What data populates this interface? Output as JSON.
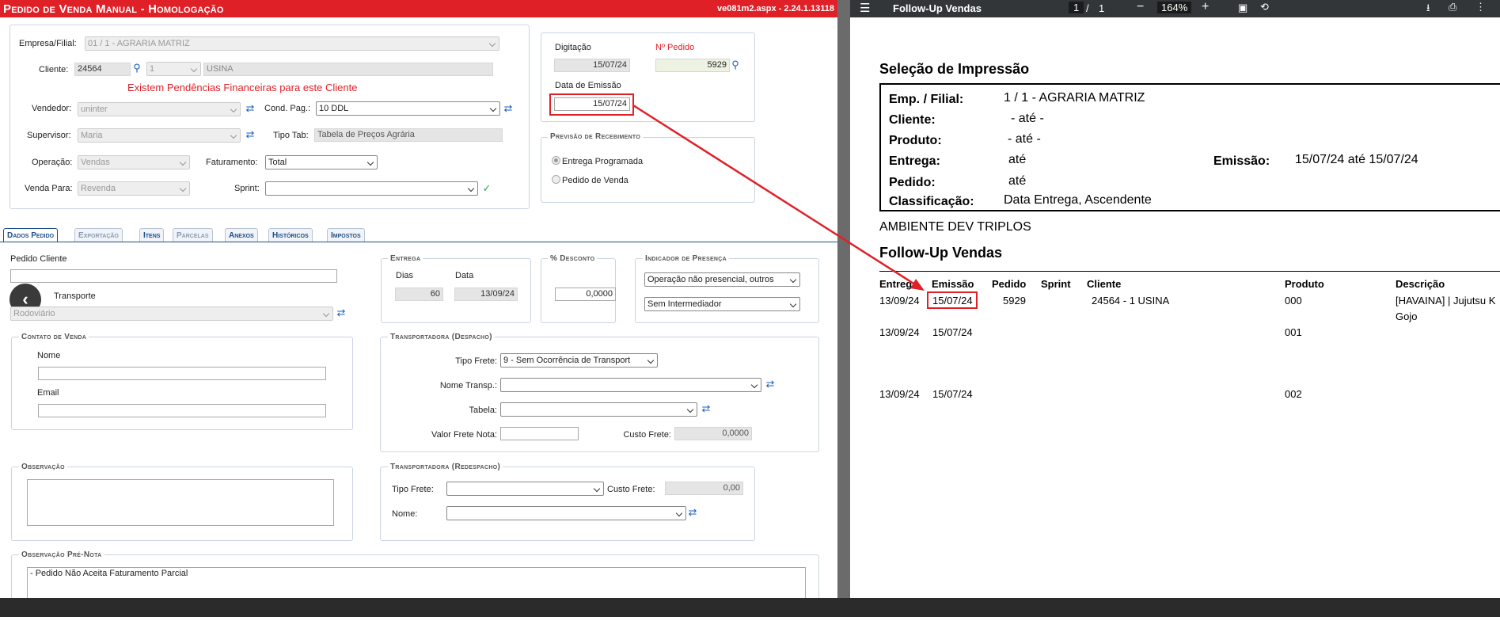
{
  "app": {
    "title": "Pedido de Venda Manual",
    "env": "- Homologação",
    "version": "ve081m2.aspx - 2.24.1.13118"
  },
  "header": {
    "empresa_label": "Empresa/Filial:",
    "empresa_value": "01 / 1 - AGRARIA MATRIZ",
    "cliente_label": "Cliente:",
    "cliente_code": "24564",
    "cliente_loja": "1",
    "cliente_name": "USINA",
    "warning": "Existem Pendências Financeiras para este Cliente",
    "vendedor_label": "Vendedor:",
    "vendedor_value": "uninter",
    "condpag_label": "Cond. Pag.:",
    "condpag_value": "10 DDL",
    "supervisor_label": "Supervisor:",
    "supervisor_value": "Maria",
    "tipotab_label": "Tipo Tab:",
    "tipotab_value": "Tabela de Preços Agrária",
    "operacao_label": "Operação:",
    "operacao_value": "Vendas",
    "faturamento_label": "Faturamento:",
    "faturamento_value": "Total",
    "vendapara_label": "Venda Para:",
    "vendapara_value": "Revenda",
    "sprint_label": "Sprint:",
    "sprint_value": ""
  },
  "datas": {
    "digitacao_label": "Digitação",
    "digitacao_value": "15/07/24",
    "npedido_label": "Nº Pedido",
    "npedido_value": "5929",
    "emissao_label": "Data de Emissão",
    "emissao_value": "15/07/24"
  },
  "previsao": {
    "legend": "Previsão de Recebimento",
    "opt1": "Entrega Programada",
    "opt2": "Pedido de Venda"
  },
  "tabs": [
    "Dados Pedido",
    "Exportação",
    "Itens",
    "Parcelas",
    "Anexos",
    "Históricos",
    "Impostos"
  ],
  "dados": {
    "pedido_cliente_label": "Pedido Cliente",
    "pedido_cliente_value": "",
    "transporte_label": "Transporte",
    "transporte_value": "Rodoviário",
    "entrega_legend": "Entrega",
    "dias_label": "Dias",
    "dias_value": "60",
    "data_label": "Data",
    "data_value": "13/09/24",
    "desconto_legend": "% Desconto",
    "desconto_value": "0,0000",
    "presenca_legend": "Indicador de Presença",
    "presenca_value": "Operação não presencial, outros",
    "intermediador_value": "Sem Intermediador",
    "contato_legend": "Contato de Venda",
    "nome_label": "Nome",
    "email_label": "Email",
    "despacho_legend": "Transportadora (Despacho)",
    "tipofrete_label": "Tipo Frete:",
    "tipofrete_value": "9 - Sem Ocorrência de Transport",
    "nometransp_label": "Nome Transp.:",
    "tabela_label": "Tabela:",
    "valorfrete_label": "Valor Frete Nota:",
    "custofrete_label": "Custo Frete:",
    "custofrete_value": "0,0000",
    "obs_legend": "Observação",
    "redespacho_legend": "Transportadora (Redespacho)",
    "r_tipofrete_label": "Tipo Frete:",
    "r_custofrete_label": "Custo Frete:",
    "r_custofrete_value": "0,00",
    "r_nome_label": "Nome:",
    "obspre_legend": "Observação Pré-Nota",
    "obspre_value": "- Pedido Não Aceita Faturamento Parcial"
  },
  "pdf": {
    "title": "Follow-Up Vendas",
    "page_current": "1",
    "page_sep": "/",
    "page_total": "1",
    "zoom": "164%",
    "sel_title": "Seleção de Impressão",
    "emp_label": "Emp. / Filial:",
    "emp_value": "1 / 1    - AGRARIA MATRIZ",
    "cliente_label": "Cliente:",
    "cliente_value": "-  até   -",
    "produto_label": "Produto:",
    "produto_value": "-  até  -",
    "entrega_label": "Entrega:",
    "entrega_value": "até",
    "emissao_label": "Emissão:",
    "emissao_value": "15/07/24 até 15/07/24",
    "pedido_label": "Pedido:",
    "pedido_value": "até",
    "class_label": "Classificação:",
    "class_value": "Data Entrega, Ascendente",
    "ambiente": "AMBIENTE DEV TRIPLOS",
    "report_title": "Follow-Up Vendas",
    "columns": [
      "Entrega",
      "Emissão",
      "Pedido",
      "Sprint",
      "Cliente",
      "Produto",
      "Descrição"
    ],
    "rows": [
      {
        "entrega": "13/09/24",
        "emissao": "15/07/24",
        "pedido": "5929",
        "cliente": "24564 - 1   USINA",
        "produto": "000",
        "descricao": "[HAVAINA] | Jujutsu K",
        "descricao2": "Gojo"
      },
      {
        "entrega": "13/09/24",
        "emissao": "15/07/24",
        "pedido": "",
        "cliente": "",
        "produto": "001",
        "descricao": "",
        "descricao2": ""
      },
      {
        "entrega": "13/09/24",
        "emissao": "15/07/24",
        "pedido": "",
        "cliente": "",
        "produto": "002",
        "descricao": "",
        "descricao2": ""
      }
    ]
  },
  "colors": {
    "accent": "#e02027",
    "link": "#1b5fc1",
    "pdfbar": "#323639"
  }
}
